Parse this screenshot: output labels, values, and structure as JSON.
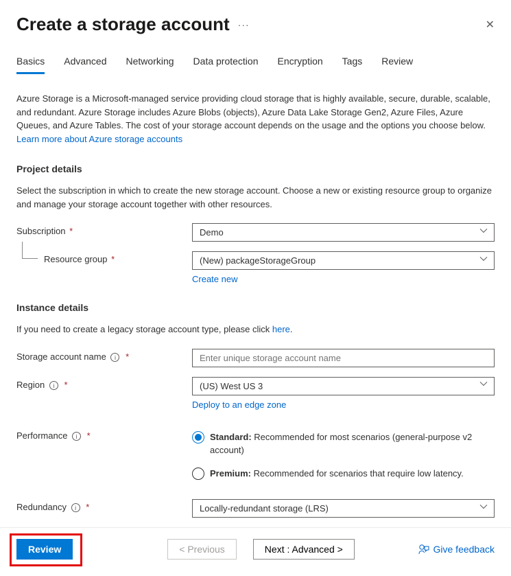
{
  "header": {
    "title": "Create a storage account"
  },
  "tabs": [
    {
      "label": "Basics",
      "active": true
    },
    {
      "label": "Advanced"
    },
    {
      "label": "Networking"
    },
    {
      "label": "Data protection"
    },
    {
      "label": "Encryption"
    },
    {
      "label": "Tags"
    },
    {
      "label": "Review"
    }
  ],
  "intro": {
    "text": "Azure Storage is a Microsoft-managed service providing cloud storage that is highly available, secure, durable, scalable, and redundant. Azure Storage includes Azure Blobs (objects), Azure Data Lake Storage Gen2, Azure Files, Azure Queues, and Azure Tables. The cost of your storage account depends on the usage and the options you choose below. ",
    "link": "Learn more about Azure storage accounts"
  },
  "sections": {
    "project": {
      "heading": "Project details",
      "desc": "Select the subscription in which to create the new storage account. Choose a new or existing resource group to organize and manage your storage account together with other resources.",
      "subscription_label": "Subscription",
      "subscription_value": "Demo",
      "resource_group_label": "Resource group",
      "resource_group_value": "(New) packageStorageGroup",
      "create_new_link": "Create new"
    },
    "instance": {
      "heading": "Instance details",
      "legacy_text": "If you need to create a legacy storage account type, please click ",
      "legacy_link": "here",
      "name_label": "Storage account name",
      "name_placeholder": "Enter unique storage account name",
      "region_label": "Region",
      "region_value": "(US) West US 3",
      "edge_link": "Deploy to an edge zone",
      "performance_label": "Performance",
      "perf_standard_bold": "Standard:",
      "perf_standard_rest": " Recommended for most scenarios (general-purpose v2 account)",
      "perf_premium_bold": "Premium:",
      "perf_premium_rest": " Recommended for scenarios that require low latency.",
      "redundancy_label": "Redundancy",
      "redundancy_value": "Locally-redundant storage (LRS)"
    }
  },
  "footer": {
    "review": "Review",
    "previous": "< Previous",
    "next": "Next : Advanced >",
    "feedback": "Give feedback"
  }
}
